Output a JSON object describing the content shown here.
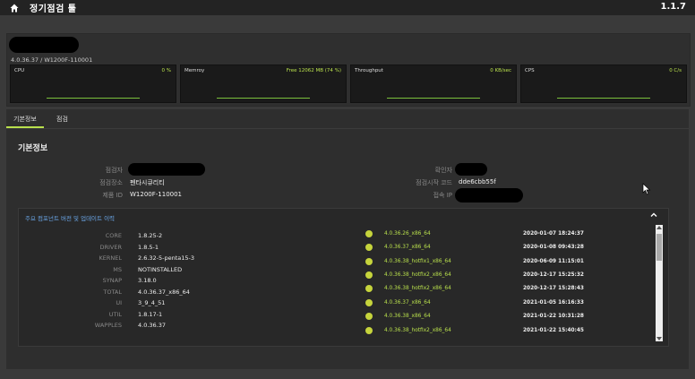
{
  "header": {
    "title": "정기점검 툴",
    "version": "1.1.7"
  },
  "device": {
    "info": "4.0.36.37 / W1200F-110001"
  },
  "metrics": [
    {
      "label": "CPU",
      "value": "0 %"
    },
    {
      "label": "Memroy",
      "value": "Free 12062 MB (74 %)"
    },
    {
      "label": "Throughput",
      "value": "0 KB/sec"
    },
    {
      "label": "CPS",
      "value": "0 C/s"
    }
  ],
  "tabs": [
    {
      "label": "기본정보"
    },
    {
      "label": "점검"
    }
  ],
  "section": {
    "title": "기본정보"
  },
  "info": {
    "inspector_label": "점검자",
    "location_label": "점검장소",
    "location_value": "펜타시큐리티",
    "product_id_label": "제품 ID",
    "product_id_value": "W1200F-110001",
    "confirmer_label": "확인자",
    "start_code_label": "점검시작 코드",
    "start_code_value": "dde6cbb55f",
    "access_ip_label": "접속 IP"
  },
  "versions": {
    "title": "주요 컴포넌트 버전 및 업데이트 이력",
    "components": [
      {
        "name": "CORE",
        "value": "1.8.25-2"
      },
      {
        "name": "DRIVER",
        "value": "1.8.5-1"
      },
      {
        "name": "KERNEL",
        "value": "2.6.32-5-penta15-3"
      },
      {
        "name": "MS",
        "value": "NOTINSTALLED"
      },
      {
        "name": "SYNAP",
        "value": "3.18.0"
      },
      {
        "name": "TOTAL",
        "value": "4.0.36.37_x86_64"
      },
      {
        "name": "UI",
        "value": "3_9_4_51"
      },
      {
        "name": "UTIL",
        "value": "1.8.17-1"
      },
      {
        "name": "WAPPLES",
        "value": "4.0.36.37"
      }
    ],
    "history": [
      {
        "version": "4.0.36.26_x86_64",
        "date": "2020-01-07 18:24:37"
      },
      {
        "version": "4.0.36.37_x86_64",
        "date": "2020-01-08 09:43:28"
      },
      {
        "version": "4.0.36.38_hotfix1_x86_64",
        "date": "2020-06-09 11:15:01"
      },
      {
        "version": "4.0.36.38_hotfix2_x86_64",
        "date": "2020-12-17 15:25:32"
      },
      {
        "version": "4.0.36.38_hotfix2_x86_64",
        "date": "2020-12-17 15:28:43"
      },
      {
        "version": "4.0.36.37_x86_64",
        "date": "2021-01-05 16:16:33"
      },
      {
        "version": "4.0.36.38_x86_64",
        "date": "2021-01-22 10:31:28"
      },
      {
        "version": "4.0.36.38_hotfix2_x86_64",
        "date": "2021-01-22 15:40:45"
      }
    ]
  },
  "colors": {
    "accent": "#b9e04c",
    "link_blue": "#6aa6e8",
    "dot": "#c6d43c",
    "background": "#3a3a3a"
  }
}
